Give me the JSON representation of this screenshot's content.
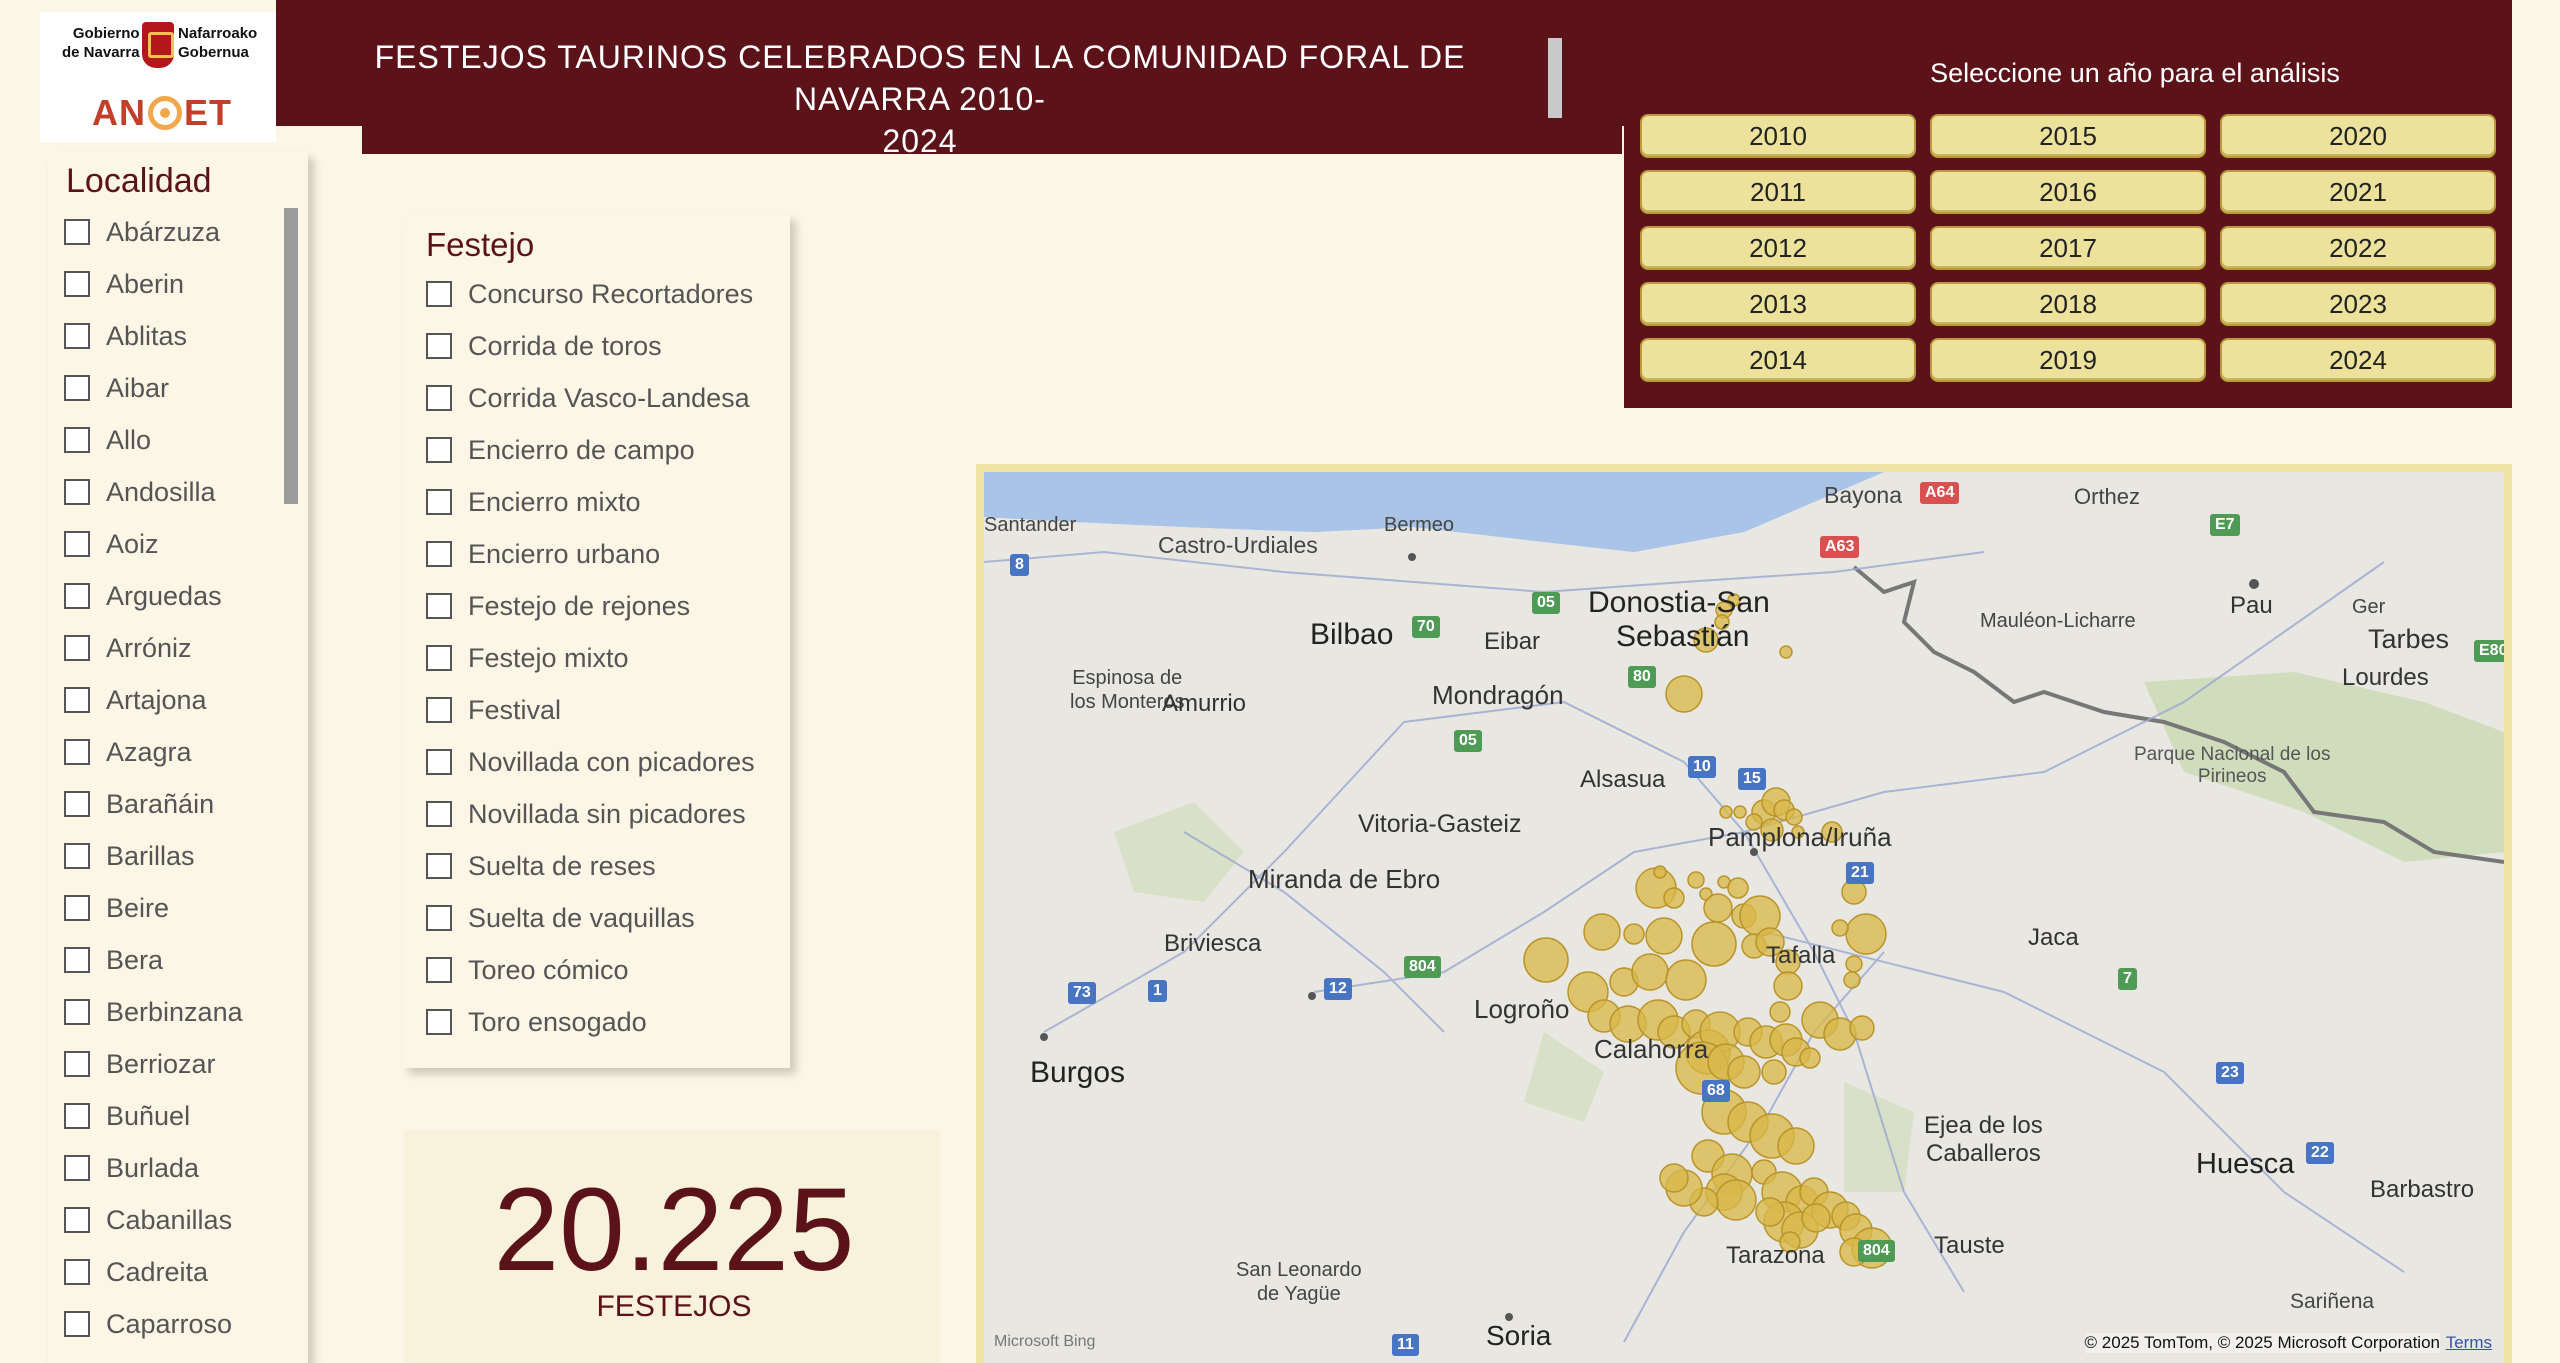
{
  "logos": {
    "gov_left_line1": "Gobierno",
    "gov_left_line2": "de Navarra",
    "gov_right_line1": "Nafarroako",
    "gov_right_line2": "Gobernua",
    "anet_left": "AN",
    "anet_right": "ET"
  },
  "header": {
    "title_line1": "FESTEJOS TAURINOS CELEBRADOS EN LA COMUNIDAD FORAL DE NAVARRA 2010-",
    "title_line2": "2024"
  },
  "years": {
    "heading": "Seleccione un año para el análisis",
    "items": [
      "2010",
      "2015",
      "2020",
      "2011",
      "2016",
      "2021",
      "2012",
      "2017",
      "2022",
      "2013",
      "2018",
      "2023",
      "2014",
      "2019",
      "2024"
    ]
  },
  "localidad": {
    "title": "Localidad",
    "items": [
      "Abárzuza",
      "Aberin",
      "Ablitas",
      "Aibar",
      "Allo",
      "Andosilla",
      "Aoiz",
      "Arguedas",
      "Arróniz",
      "Artajona",
      "Azagra",
      "Barañáin",
      "Barillas",
      "Beire",
      "Bera",
      "Berbinzana",
      "Berriozar",
      "Buñuel",
      "Burlada",
      "Cabanillas",
      "Cadreita",
      "Caparroso"
    ]
  },
  "festejo": {
    "title": "Festejo",
    "items": [
      "Concurso Recortadores",
      "Corrida de toros",
      "Corrida Vasco-Landesa",
      "Encierro de campo",
      "Encierro mixto",
      "Encierro urbano",
      "Festejo de rejones",
      "Festejo mixto",
      "Festival",
      "Novillada con picadores",
      "Novillada sin picadores",
      "Suelta de reses",
      "Suelta de vaquillas",
      "Toreo cómico",
      "Toro ensogado"
    ]
  },
  "kpi": {
    "value": "20.225",
    "label": "FESTEJOS"
  },
  "map": {
    "places": {
      "santander": "Santander",
      "castro": "Castro-Urdiales",
      "bermeo": "Bermeo",
      "bayona": "Bayona",
      "orthez": "Orthez",
      "bilbao": "Bilbao",
      "eibar": "Eibar",
      "donostia1": "Donostia-San",
      "donostia2": "Sebastián",
      "mauleon": "Mauléon-Licharre",
      "pau": "Pau",
      "ger": "Ger",
      "tarbes": "Tarbes",
      "lourdes": "Lourdes",
      "espinosa1": "Espinosa de",
      "espinosa2": "los Monteros",
      "amurrio": "Amurrio",
      "mondragon": "Mondragón",
      "parque1": "Parque Nacional de los",
      "parque2": "Pirineos",
      "alsasua": "Alsasua",
      "vitoria": "Vitoria-Gasteiz",
      "pamplona": "Pamplona/Iruña",
      "miranda": "Miranda de Ebro",
      "briviesca": "Briviesca",
      "tafalla": "Tafalla",
      "jaca": "Jaca",
      "logrono": "Logroño",
      "burgos": "Burgos",
      "calahorra": "Calahorra",
      "ejea1": "Ejea de los",
      "ejea2": "Caballeros",
      "huesca": "Huesca",
      "barbastro": "Barbastro",
      "tarazona": "Tarazona",
      "tauste": "Tauste",
      "sanleonardo1": "San Leonardo",
      "sanleonardo2": "de Yagüe",
      "soria": "Soria",
      "sarinena": "Sariñena"
    },
    "road_shields": {
      "a64": "A64",
      "a63": "A63",
      "e7": "E7",
      "e80": "E80",
      "r8": "8",
      "r70": "70",
      "r05a": "05",
      "r80": "80",
      "r05b": "05",
      "r10": "10",
      "r15": "15",
      "r21": "21",
      "r804a": "804",
      "r12": "12",
      "r73": "73",
      "r1": "1",
      "r7": "7",
      "r68": "68",
      "r23": "23",
      "r22": "22",
      "r804b": "804",
      "r11": "11"
    },
    "attribution": "© 2025 TomTom, © 2025 Microsoft Corporation",
    "terms": "Terms",
    "bing": "Microsoft Bing",
    "colors": {
      "bubble": "#d9b84a",
      "bubble_stroke": "#b8942a",
      "sea": "#a9c4e6",
      "land": "#e9e7e2"
    }
  }
}
